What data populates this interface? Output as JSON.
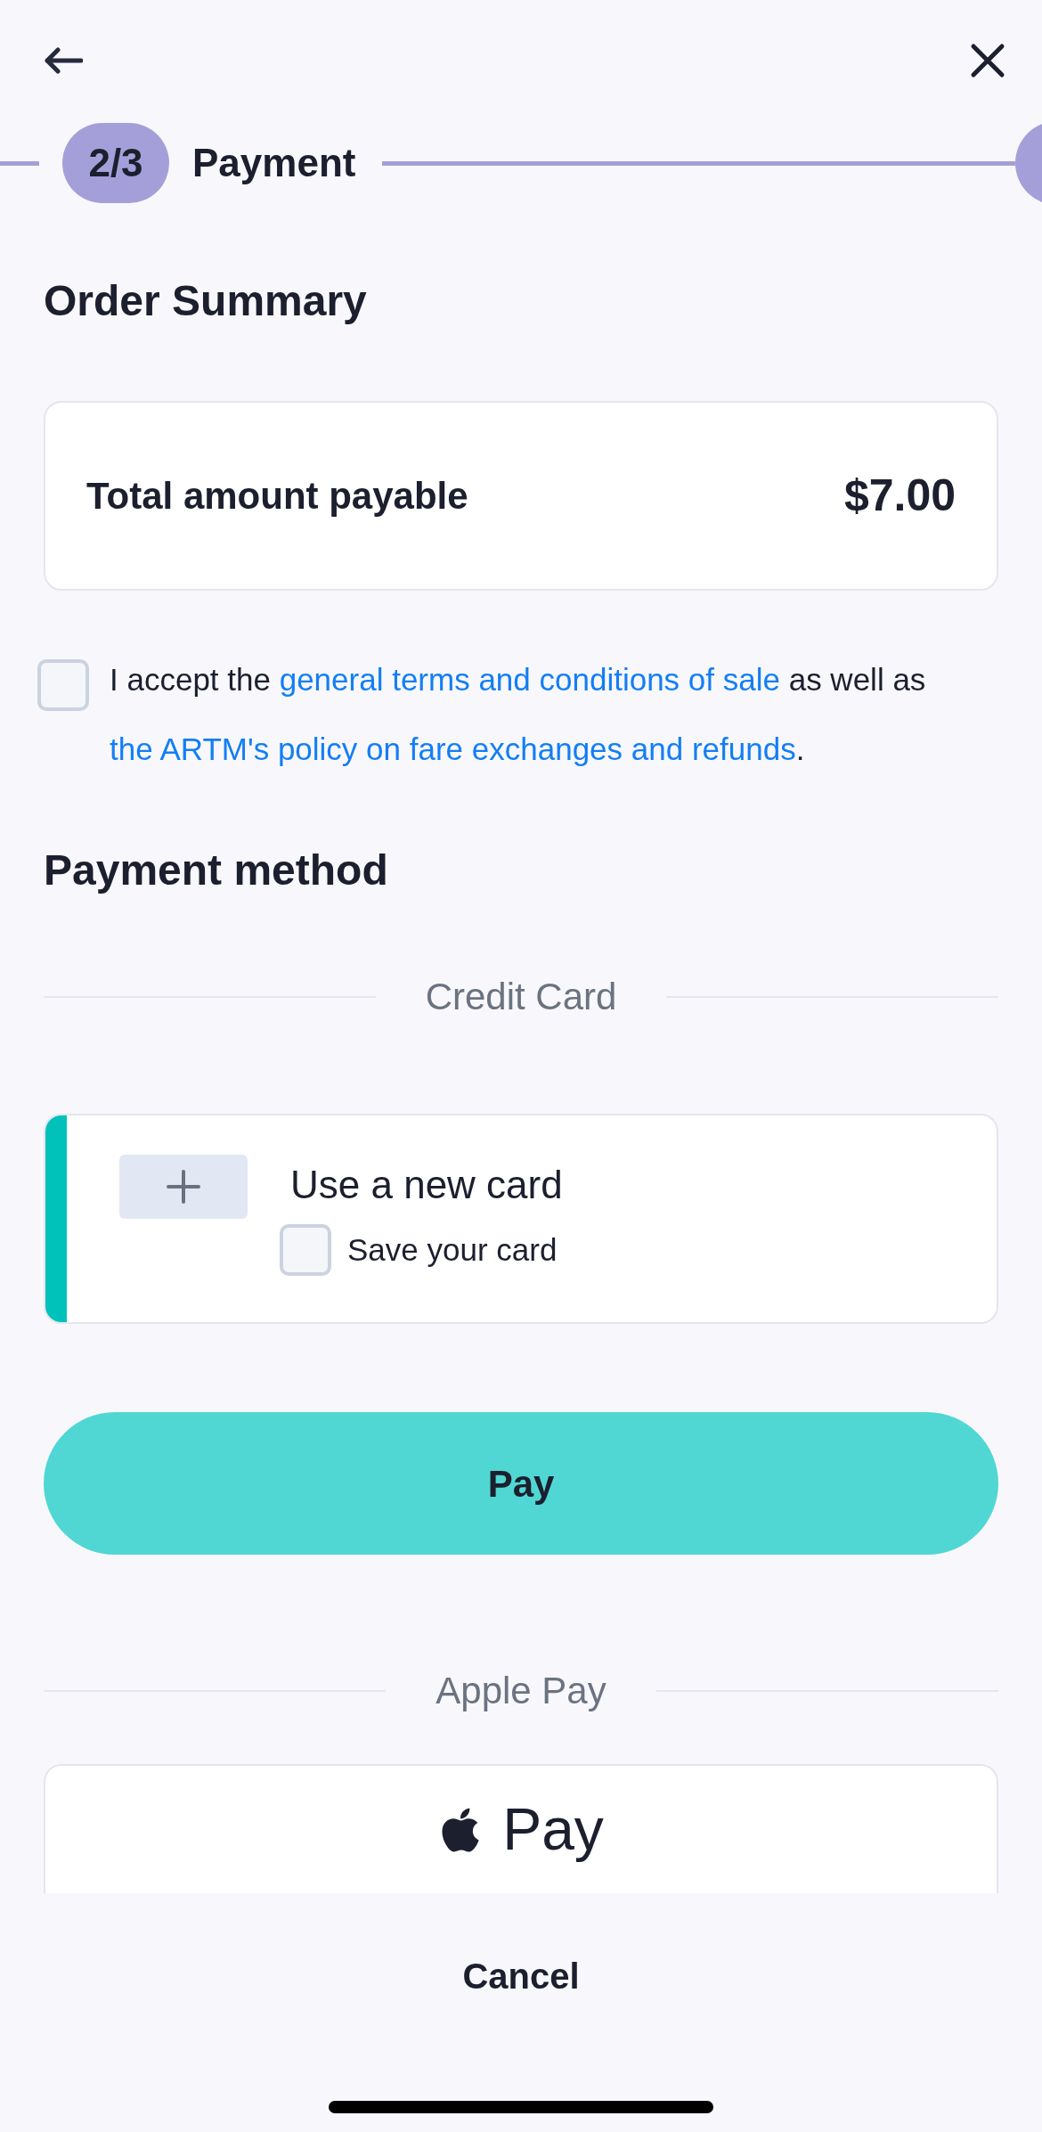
{
  "stepper": {
    "step": "2/3",
    "label": "Payment"
  },
  "order_summary": {
    "title": "Order Summary",
    "total_label": "Total amount payable",
    "total_value": "$7.00"
  },
  "terms": {
    "checked": false,
    "segments": [
      {
        "kind": "text",
        "text": "I accept the "
      },
      {
        "kind": "link",
        "text": "general terms and conditions of sale"
      },
      {
        "kind": "text",
        "text": " as well as "
      },
      {
        "kind": "link",
        "text": "the ARTM's policy on fare exchanges and refunds"
      },
      {
        "kind": "text",
        "text": "."
      }
    ]
  },
  "payment_method": {
    "title": "Payment method",
    "sections": [
      {
        "kind": "card",
        "divider": "Credit Card",
        "card_title": "Use a new card",
        "save_label": "Save your card",
        "save_checked": false,
        "button": "Pay"
      },
      {
        "kind": "apple_pay",
        "divider": "Apple Pay",
        "button": "Pay"
      }
    ]
  },
  "cancel": "Cancel"
}
